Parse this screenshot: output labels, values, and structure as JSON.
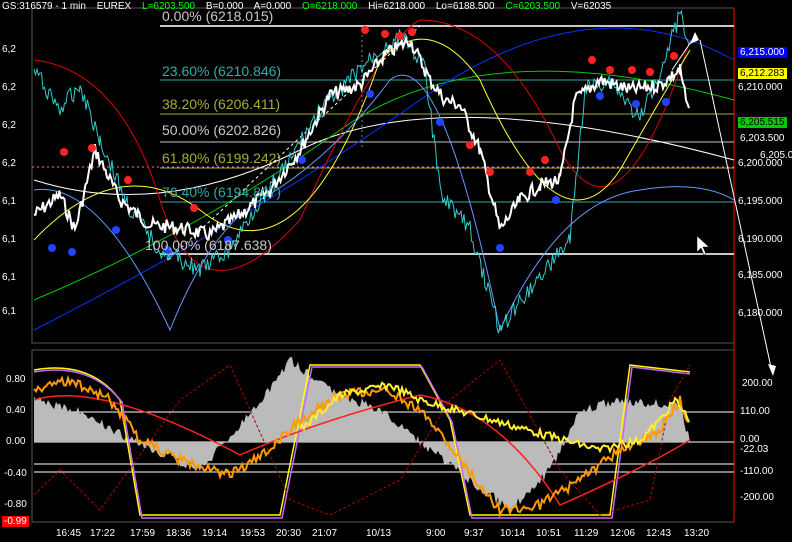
{
  "header": {
    "symbol": "GS:316579 - 1 min",
    "exchange": "EUREX",
    "last": "L=6203.500",
    "bid": "B=0.000",
    "ask": "A=0.000",
    "open": "O=6218.000",
    "high": "Hi=6218.000",
    "low": "Lo=6188.500",
    "close": "C=6203.500",
    "volume": "V=62035"
  },
  "colors": {
    "close_tag_green": "#00cc00",
    "fib_line_yellow": "#ffff00",
    "price_axis_blue": "#0000ff",
    "cyan": "#00ffff",
    "red": "#ff0000"
  },
  "price_axis": {
    "left_ticks": [
      "6,2",
      "6,2",
      "6,2",
      "6,2",
      "6,1",
      "6,1",
      "6,1",
      "6,1"
    ],
    "right_ticks": [
      "6,210.000",
      "6,205.000",
      "6,200.000",
      "6,195.000",
      "6,190.000",
      "6,185.000",
      "6,180.000"
    ],
    "tags": {
      "top_blue": "6,215.000",
      "yellow": "6,212.283",
      "green": "6,205.515",
      "last": "6,203.500"
    }
  },
  "fib_levels": [
    {
      "label": "0.00% (6218.015)",
      "color": "#c8c8c8"
    },
    {
      "label": "23.60% (6210.846)",
      "color": "#33aaaa"
    },
    {
      "label": "38.20% (6206.411)",
      "color": "#aaaa33"
    },
    {
      "label": "50.00% (6202.826)",
      "color": "#c8c8c8"
    },
    {
      "label": "61.80% (6199.242)",
      "color": "#aaaa33"
    },
    {
      "label": "76.40% (6194.807)",
      "color": "#33aaaa"
    },
    {
      "label": "100.00% (6187.638)",
      "color": "#c8c8c8"
    }
  ],
  "oscillator": {
    "left_ticks": [
      "0.80",
      "0.40",
      "0.00",
      "-0.40",
      "-0.80"
    ],
    "right_ticks": [
      "200.00",
      "110.00",
      "0.00",
      "-22.03",
      "-110.00",
      "-200.00"
    ],
    "bottom_value": "-0.99"
  },
  "time_axis": [
    "16:45",
    "17:22",
    "17:59",
    "18:36",
    "19:14",
    "19:53",
    "20:30",
    "21:07",
    "10/13",
    "9:00",
    "9:37",
    "10:14",
    "10:51",
    "11:29",
    "12:06",
    "12:43",
    "13:20"
  ]
}
